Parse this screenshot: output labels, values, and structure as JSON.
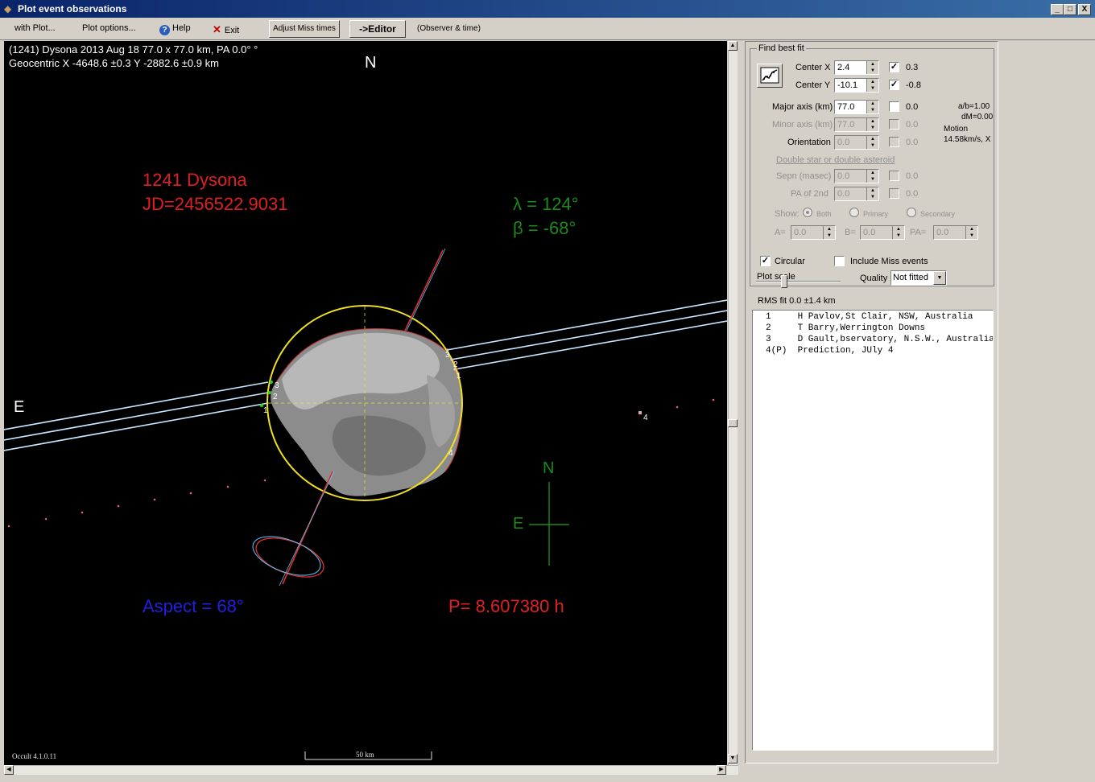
{
  "window": {
    "title": "Plot event observations",
    "minimize": "_",
    "restore": "□",
    "close": "X"
  },
  "menu": {
    "with_plot": "with Plot...",
    "plot_options": "Plot options...",
    "help": "Help",
    "exit": "Exit",
    "adjust_miss_times": "Adjust Miss times",
    "editor": "->Editor",
    "observer_time": "(Observer & time)"
  },
  "plot": {
    "header_line1": "(1241) Dysona  2013 Aug 18  77.0 x 77.0 km, PA 0.0° °",
    "header_line2": "Geocentric X -4648.6 ±0.3  Y -2882.6 ±0.9 km",
    "north": "N",
    "east": "E",
    "asteroid_name": "1241 Dysona",
    "jd": "JD=2456522.9031",
    "lambda": "λ =  124°",
    "beta": "β =  -68°",
    "aspect": "Aspect = 68°",
    "period": "P= 8.607380 h",
    "compass_n": "N",
    "compass_e": "E",
    "version": "Occult 4.1.0.11",
    "scale_label": "50 km",
    "chord_labels": [
      "1",
      "2",
      "3",
      "1",
      "2",
      "3",
      "4",
      "4"
    ],
    "colors": {
      "limb": "#f0e020",
      "chord": "#c8e8ff",
      "prediction": "#e06080",
      "axis": "#e03030",
      "green": "#1a8a1a"
    }
  },
  "panel": {
    "group_title": "Find best fit",
    "center_x_label": "Center X",
    "center_x_value": "2.4",
    "center_x_fit_value": "0.3",
    "center_y_label": "Center Y",
    "center_y_value": "-10.1",
    "center_y_fit_value": "-0.8",
    "major_axis_label": "Major axis (km)",
    "major_axis_value": "77.0",
    "major_axis_fit_value": "0.0",
    "minor_axis_label": "Minor axis (km)",
    "minor_axis_value": "77.0",
    "minor_axis_fit_value": "0.0",
    "orientation_label": "Orientation",
    "orientation_value": "0.0",
    "orientation_fit_value": "0.0",
    "ab_ratio": "a/b=1.00",
    "dm": "dM=0.00",
    "motion_label": "Motion",
    "motion_value": "14.58km/s, X",
    "double_star_link": "Double star  or  double asteroid",
    "sepn_label": "Sepn (masec)",
    "sepn_value": "0.0",
    "sepn_fit_value": "0.0",
    "pa2_label": "PA of 2nd",
    "pa2_value": "0.0",
    "pa2_fit_value": "0.0",
    "show_label": "Show:",
    "show_both": "Both",
    "show_primary": "Primary",
    "show_secondary": "Secondary",
    "a_label": "A=",
    "a_value": "0.0",
    "b_label": "B=",
    "b_value": "0.0",
    "pa_label": "PA=",
    "pa_value": "0.0",
    "circular_label": "Circular",
    "include_miss_label": "Include Miss events",
    "plot_scale_label": "Plot scale",
    "quality_label": "Quality",
    "quality_value": "Not fitted",
    "rms_fit": "RMS fit 0.0 ±1.4 km",
    "observers": [
      "1     H Pavlov,St Clair, NSW, Australia",
      "2     T Barry,Werrington Downs",
      "3     D Gault,bservatory, N.S.W., Australia",
      "4(P)  Prediction, JUly 4"
    ]
  }
}
